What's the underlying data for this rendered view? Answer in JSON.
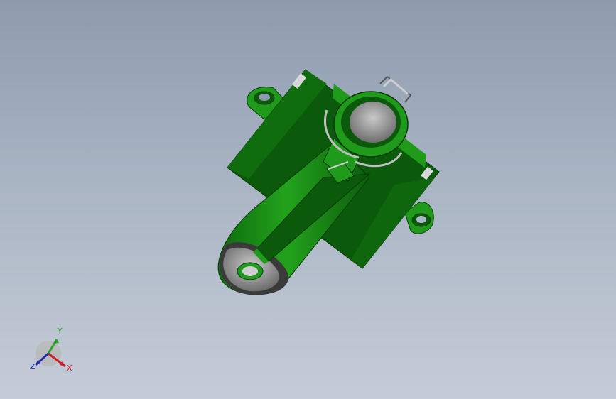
{
  "viewport": {
    "model_name": "green-bracket-assembly",
    "colors": {
      "background_top": "#8d9bad",
      "background_bottom": "#c5ccd7",
      "part_light": "#1f9a1a",
      "part_dark": "#0b5a0b",
      "bore_grey": "#a7a7a7"
    }
  },
  "triad": {
    "x_label": "X",
    "y_label": "Y",
    "z_label": "Z",
    "x_color": "#c8202a",
    "y_color": "#2aa12a",
    "z_color": "#2230a8"
  }
}
